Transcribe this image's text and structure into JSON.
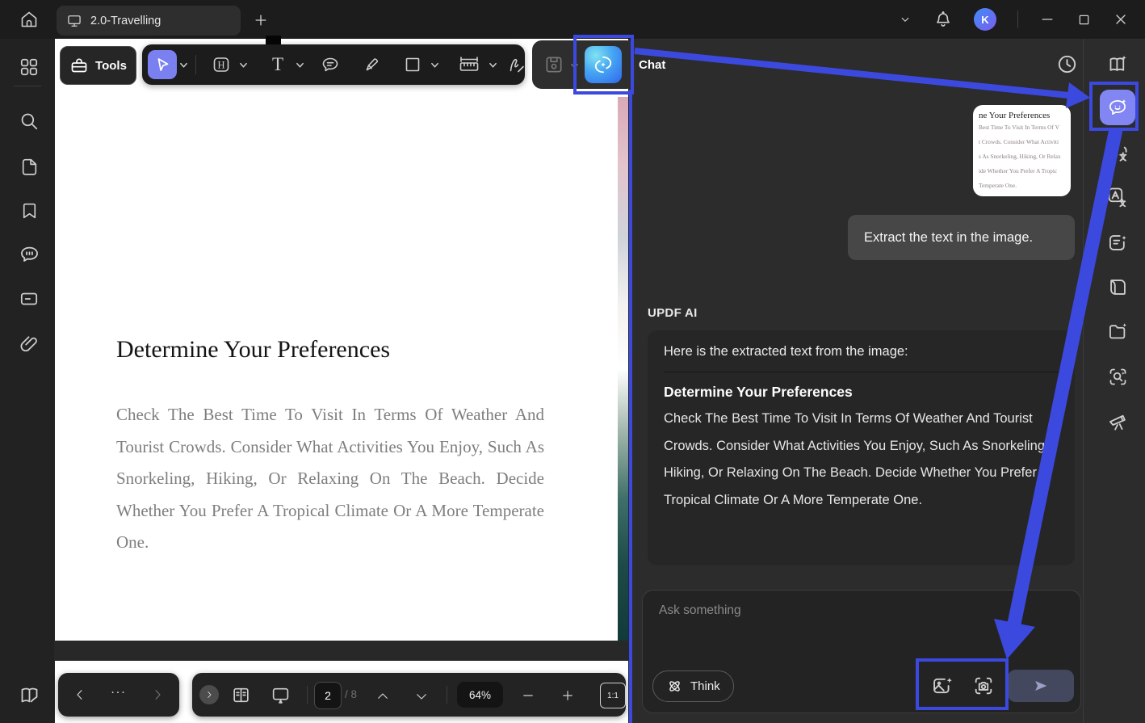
{
  "window": {
    "tab_title": "2.0-Travelling",
    "avatar_initial": "K"
  },
  "toolbar": {
    "tools_label": "Tools"
  },
  "document": {
    "title": "Determine Your Preferences",
    "body": "Check The Best Time To Visit In Terms Of Weather And Tourist Crowds. Consider What Activities You Enjoy, Such As Snorkeling, Hiking, Or Relaxing On The Beach. Decide Whether You Prefer A Tropical Climate Or A More Temperate One."
  },
  "bottom_bar": {
    "current_page": "2",
    "page_total": "/ 8",
    "zoom_level": "64%",
    "actual_size_label": "1:1",
    "more_label": "..."
  },
  "chat": {
    "header": "Chat",
    "thumbnail": {
      "title": "ne Your Preferences",
      "lines": {
        "0": "Best Time To Visit In Terms Of V",
        "1": "t Crowds. Consider What Activiti",
        "2": "s As Snorkeling, Hiking, Or Relax",
        "3": "ide Whether You Prefer A Tropic",
        "4": "Temperate One."
      }
    },
    "user_message": "Extract the text in the image.",
    "ai_name": "UPDF AI",
    "ai_response": {
      "intro": "Here is the extracted text from the image:",
      "heading": "Determine Your Preferences",
      "body": "Check The Best Time To Visit In Terms Of Weather And Tourist Crowds. Consider What Activities You Enjoy, Such As Snorkeling, Hiking, Or Relaxing On The Beach. Decide Whether You Prefer A Tropical Climate Or A More Temperate One."
    },
    "input_placeholder": "Ask something",
    "think_label": "Think"
  },
  "colors": {
    "annotation_blue": "#3c49de",
    "active_tool": "#7b80f0",
    "ai_icon_gradient_start": "#7fe3f2",
    "ai_icon_gradient_end": "#2f66ee"
  }
}
